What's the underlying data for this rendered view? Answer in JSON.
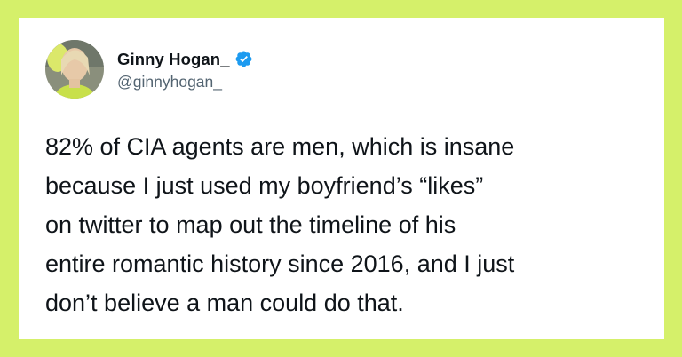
{
  "colors": {
    "background": "#d5f06a",
    "card": "#ffffff",
    "text_primary": "#0f1419",
    "text_secondary": "#536471",
    "verified_blue": "#1d9bf0"
  },
  "tweet": {
    "author": {
      "display_name": "Ginny Hogan_",
      "handle": "@ginnyhogan_",
      "verified_icon": "verified-badge-icon"
    },
    "text_lines": [
      "82% of CIA agents are men, which is insane",
      "because I just used my boyfriend’s “likes”",
      "on twitter to map out the timeline of his",
      "entire romantic history since 2016, and I just",
      "don’t believe a man could do that."
    ]
  }
}
